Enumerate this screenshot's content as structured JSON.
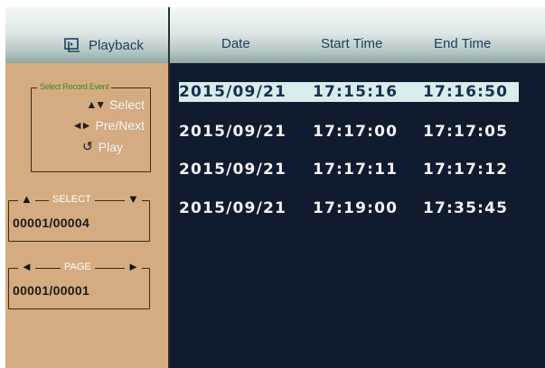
{
  "header": {
    "title": "Playback",
    "columns": {
      "date": "Date",
      "start_time": "Start Time",
      "end_time": "End Time"
    }
  },
  "sidebar": {
    "events_box": {
      "legend": "Select Record Event",
      "items": [
        {
          "icon": "up-down-arrows-icon",
          "label": "Select"
        },
        {
          "icon": "left-right-arrows-icon",
          "label": "Pre/Next"
        },
        {
          "icon": "replay-icon",
          "label": "Play"
        }
      ]
    },
    "select_box": {
      "label": "SELECT",
      "counter": "00001/00004"
    },
    "page_box": {
      "label": "PAGE",
      "counter": "00001/00001"
    }
  },
  "records": [
    {
      "date": "2015/09/21",
      "start": "17:15:16",
      "end": "17:16:50",
      "selected": true
    },
    {
      "date": "2015/09/21",
      "start": "17:17:00",
      "end": "17:17:05",
      "selected": false
    },
    {
      "date": "2015/09/21",
      "start": "17:17:11",
      "end": "17:17:12",
      "selected": false
    },
    {
      "date": "2015/09/21",
      "start": "17:19:00",
      "end": "17:35:45",
      "selected": false
    }
  ],
  "colors": {
    "left_panel": "#d5ac81",
    "right_panel": "#0f1b2e",
    "selected_row": "#d9ecec",
    "header_text": "#1e3f5a",
    "legend_text": "#3a8a2a"
  }
}
